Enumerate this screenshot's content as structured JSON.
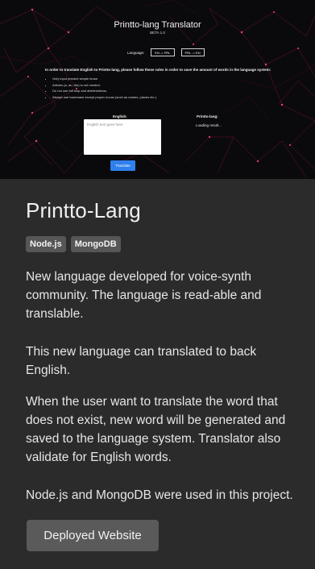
{
  "preview": {
    "title": "Printto-lang Translator",
    "beta": "BETA 1.0",
    "language_label": "Language:",
    "lang_buttons": [
      "EN -> PRL",
      "PRL -> EN"
    ],
    "rules_intro": "In order to translate English to Printto-lang, please follow these rules in order to save the amount of words in the language system:",
    "rules": [
      "Only input present simple tense.",
      "Articles (a, an, the) is not needed.",
      "Do not use full stop and abbreviations.",
      "Always use lowercase except proper nouns (such as names, places etc.)"
    ],
    "english_label": "English:",
    "printto_label": "Printto-lang:",
    "textarea_placeholder": "English text goes here",
    "result_text": "Loading result...",
    "translate_button": "Translate"
  },
  "card": {
    "title": "Printto-Lang",
    "tags": [
      "Node.js",
      "MongoDB"
    ],
    "paragraphs": [
      "New language developed for voice-synth community. The language is read-able and translable.",
      "This new language can translated to back English.",
      "When the user want to translate the word that does not exist, new word will be generated and saved to the language system. Translator also validate for English words.",
      "Node.js and MongoDB were used in this project."
    ],
    "deploy_button": "Deployed Website"
  },
  "colors": {
    "card_bg": "#2b2b2b",
    "tag_bg": "#565656",
    "button_bg": "#5a5a5a",
    "preview_accent": "#c4145a",
    "translate_blue": "#2f80ed"
  }
}
